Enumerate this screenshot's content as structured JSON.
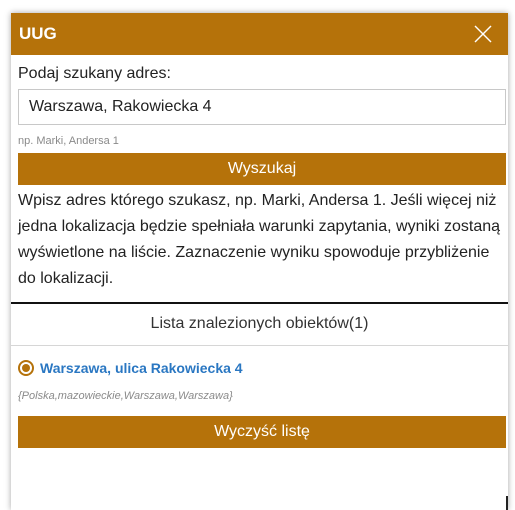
{
  "dialog": {
    "title": "UUG",
    "close_icon": "close-icon"
  },
  "search": {
    "label": "Podaj szukany adres:",
    "value": "Warszawa, Rakowiecka 4",
    "hint": "np. Marki, Andersa 1",
    "button_label": "Wyszukaj"
  },
  "description": "Wpisz adres którego szukasz, np. Marki, Andersa 1. Jeśli więcej niż jedna lokalizacja będzie spełniała warunki zapytania, wyniki zostaną wyświetlone na liście. Zaznaczenie wyniku spowoduje przybliżenie do lokalizacji.",
  "results": {
    "header": "Lista znalezionych obiektów(1)",
    "items": [
      {
        "name": "Warszawa, ulica Rakowiecka 4",
        "detail": "{Polska,mazowieckie,Warszawa,Warszawa}",
        "selected": true
      }
    ],
    "clear_label": "Wyczyść listę"
  },
  "colors": {
    "accent": "#b5720a",
    "link": "#2a77c2"
  }
}
